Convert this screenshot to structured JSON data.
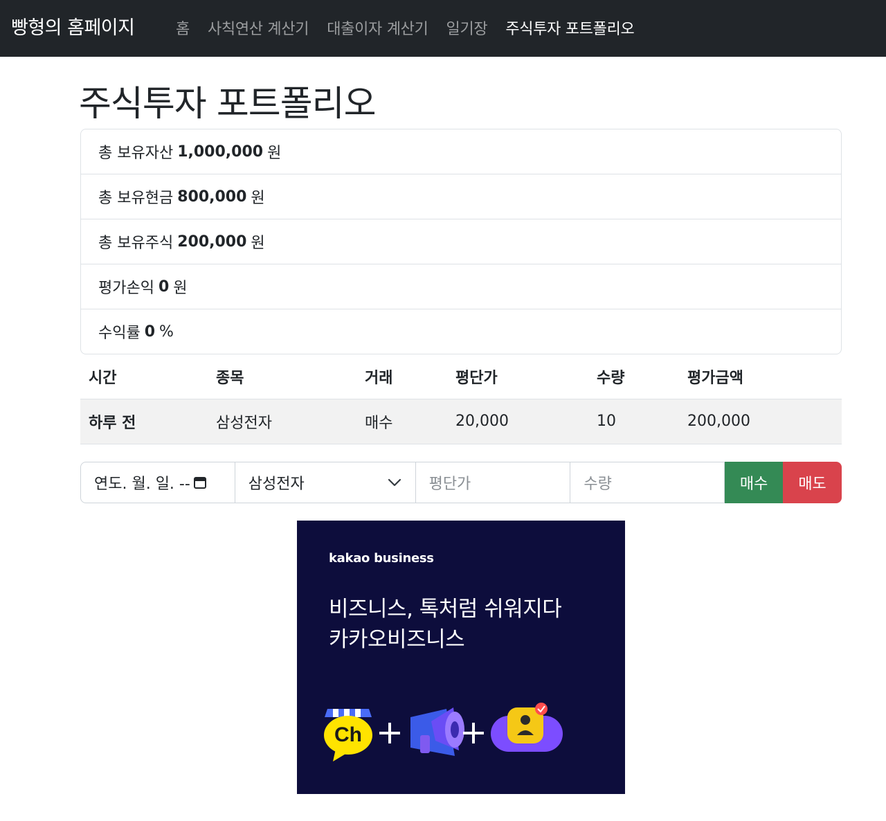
{
  "nav": {
    "brand": "빵형의 홈페이지",
    "links": [
      "홈",
      "사칙연산 계산기",
      "대출이자 계산기",
      "일기장",
      "주식투자 포트폴리오"
    ],
    "active_index": 4
  },
  "page": {
    "title": "주식투자 포트폴리오"
  },
  "summary": [
    {
      "label": "총 보유자산",
      "value": "1,000,000",
      "unit": "원"
    },
    {
      "label": "총 보유현금",
      "value": "800,000",
      "unit": "원"
    },
    {
      "label": "총 보유주식",
      "value": "200,000",
      "unit": "원"
    },
    {
      "label": "평가손익",
      "value": "0",
      "unit": "원"
    },
    {
      "label": "수익률",
      "value": "0",
      "unit": "%"
    }
  ],
  "table": {
    "headers": [
      "시간",
      "종목",
      "거래",
      "평단가",
      "수량",
      "평가금액"
    ],
    "rows": [
      [
        "하루 전",
        "삼성전자",
        "매수",
        "20,000",
        "10",
        "200,000"
      ]
    ]
  },
  "form": {
    "date_placeholder": "연도. 월. 일. --",
    "selected_stock": "삼성전자",
    "price_placeholder": "평단가",
    "qty_placeholder": "수량",
    "buy_label": "매수",
    "sell_label": "매도"
  },
  "ad": {
    "brand": "kakao business",
    "line1": "비즈니스, 톡처럼 쉬워지다",
    "line2": "카카오비즈니스",
    "icon_ch_text": "Ch",
    "icons": [
      "kakao-channel-icon",
      "megaphone-icon",
      "profile-badge-icon"
    ]
  },
  "colors": {
    "navbar_bg": "#212529",
    "buy_button": "#348a55",
    "sell_button": "#d9434c",
    "ad_bg": "#0d0d3c"
  }
}
